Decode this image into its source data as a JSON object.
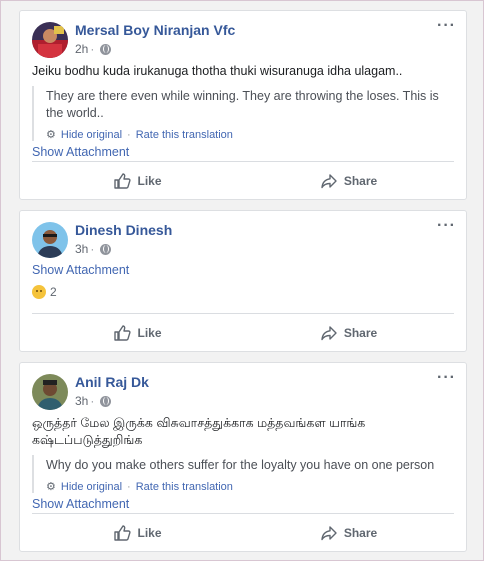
{
  "comments": [
    {
      "author": "Mersal Boy Niranjan Vfc",
      "time": "2h",
      "text": "Jeiku bodhu kuda irukanuga thotha thuki wisuranuga idha ulagam..",
      "translation": "They are there even while winning. They are throwing the loses. This is the world..",
      "hide_original": "Hide original",
      "rate_translation": "Rate this translation",
      "attachment": "Show Attachment",
      "like": "Like",
      "share": "Share"
    },
    {
      "author": "Dinesh Dinesh",
      "time": "3h",
      "attachment": "Show Attachment",
      "reaction_count": "2",
      "like": "Like",
      "share": "Share"
    },
    {
      "author": "Anil Raj Dk",
      "time": "3h",
      "text": "ஒருத்தர் மேல இருக்க விசுவாசத்துக்காக மத்தவங்கள யாங்க கஷ்டப்படுத்துறிங்க",
      "translation": "Why do you make others suffer for the loyalty you have on one person",
      "hide_original": "Hide original",
      "rate_translation": "Rate this translation",
      "attachment": "Show Attachment",
      "like": "Like",
      "share": "Share"
    }
  ],
  "icons": {
    "options": "ellipsis-icon",
    "audience": "globe-icon",
    "settings": "gear-icon",
    "like": "thumbs-up-icon",
    "share": "share-arrow-icon",
    "reaction": "sad-face-icon"
  }
}
